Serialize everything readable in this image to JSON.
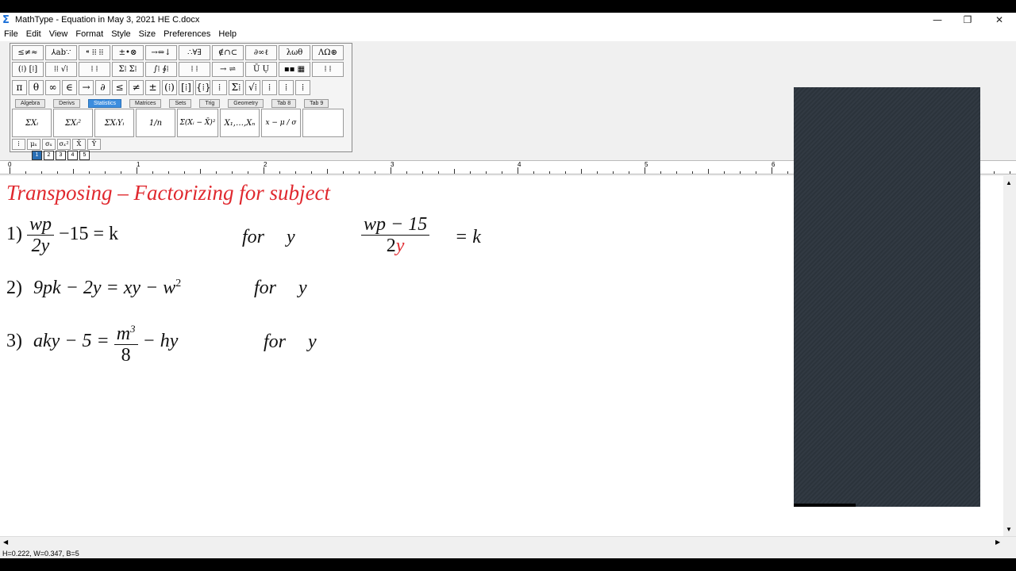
{
  "window": {
    "title": "MathType - Equation in May 3, 2021   HE C.docx",
    "app_icon": "Σ",
    "controls": {
      "minimize": "—",
      "maximize": "❐",
      "close": "✕"
    }
  },
  "menu": [
    "File",
    "Edit",
    "View",
    "Format",
    "Style",
    "Size",
    "Preferences",
    "Help"
  ],
  "toolbar": {
    "row1": [
      "≤≠≈",
      "⅄ab∵",
      "⁌ ⁞⁞ ⁞⁞",
      "±•⊗",
      "→⇔↓",
      "∴∀∃",
      "∉∩⊂",
      "∂∞ℓ",
      "λωθ",
      "ΛΩ⊛"
    ],
    "row2": [
      "(⁞) [⁞]",
      "⁞⁞ √⁞",
      "⁞ ⁞",
      "Σ⁞ Σ⁞",
      "∫⁞ ∮⁞",
      "⁞ ⁞",
      "→ ⇌",
      "Ū Ụ",
      "▪▪ ▦",
      "⁞ ⁞"
    ],
    "row3": [
      "π",
      "θ",
      "∞",
      "∈",
      "→",
      "∂",
      "≤",
      "≠",
      "±",
      "(⁞)",
      "[⁞]",
      "{⁞}",
      "⁞",
      "Σ⁞",
      "√⁞",
      "⁞",
      "⁞",
      "⁞"
    ],
    "tabs": [
      "Algebra",
      "Derivs",
      "Statistics",
      "Matrices",
      "Sets",
      "Trig",
      "Geometry",
      "Tab 8",
      "Tab 9"
    ],
    "active_tab": "Statistics",
    "templates": [
      "ΣXᵢ",
      "ΣXᵢ²",
      "ΣXᵢYᵢ",
      "1/n",
      "Σ(Xᵢ − X̄)²",
      "X₁,…,Xₙ",
      "x − μ / σ",
      ""
    ],
    "row5": [
      "⁞",
      "μₓ",
      "σₓ",
      "σₓ²",
      "X̄",
      "Ȳ"
    ],
    "size_buttons": [
      "1",
      "2",
      "3",
      "4",
      "5"
    ]
  },
  "ruler": {
    "labels": [
      "0",
      "1",
      "2",
      "3",
      "4",
      "5",
      "6"
    ]
  },
  "document": {
    "heading": "Transposing – Factorizing  for subject",
    "eq1": {
      "num": "1)",
      "frac_num": "wp",
      "frac_den": "2y",
      "rest": "−15 = k",
      "for_word": "for",
      "var": "y",
      "work_num": "wp − 15",
      "work_den_coef": "2",
      "work_den_var": "y",
      "work_rhs": "= k"
    },
    "eq2": {
      "num": "2)",
      "text": "9pk − 2y = xy − w",
      "sup": "2",
      "for_word": "for",
      "var": "y"
    },
    "eq3": {
      "num": "3)",
      "lhs": "aky − 5 =",
      "frac_num": "m",
      "frac_sup": "3",
      "frac_den": "8",
      "rest": "− hy",
      "for_word": "for",
      "var": "y"
    }
  },
  "status": "H=0.222, W=0.347, B=5",
  "colors": {
    "accent": "#3c8dde",
    "heading_red": "#e0282e",
    "overlay": "#2b333b"
  }
}
